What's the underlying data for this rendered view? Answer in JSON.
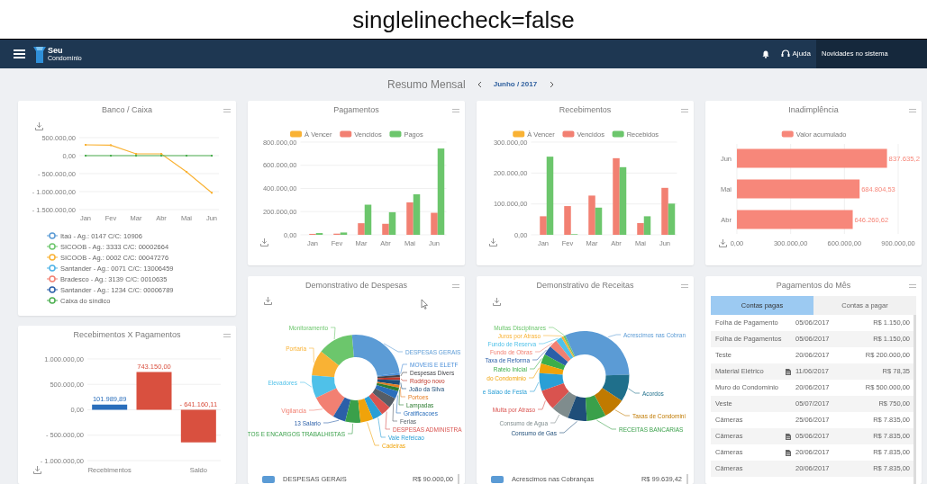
{
  "caption": "singlelinecheck=false",
  "header": {
    "brand_top": "Seu",
    "brand_bottom": "Condomínio",
    "help": "Ajuda",
    "news": "Novidades no sistema"
  },
  "summary": {
    "title": "Resumo Mensal",
    "period": "Junho / 2017"
  },
  "panels": [
    {
      "kind": "line",
      "chart_data": {
        "type": "line",
        "title": "Banco / Caixa",
        "grid": true,
        "legend": "bottom",
        "categories": [
          "Jan",
          "Fev",
          "Mar",
          "Abr",
          "Mai",
          "Jun"
        ],
        "ylim": [
          -1500000,
          500000
        ],
        "yticks": [
          {
            "value": 500000,
            "label": "500.000,00"
          },
          {
            "value": 0,
            "label": "0,00"
          },
          {
            "value": -500000,
            "label": "- 500.000,00"
          },
          {
            "value": -1000000,
            "label": "- 1.000.000,00"
          },
          {
            "value": -1500000,
            "label": "- 1.500.000,00"
          }
        ],
        "series": [
          {
            "name": "Itaú - Ag.: 0147 C/C: 10906",
            "color": "#5b9bd5",
            "values": [
              null,
              null,
              null,
              null,
              null,
              null
            ]
          },
          {
            "name": "SICOOB - Ag.: 3333 C/C: 00002664",
            "color": "#6cc66c",
            "values": [
              null,
              null,
              null,
              null,
              null,
              null
            ]
          },
          {
            "name": "SICOOB - Ag.: 0002 C/C: 00047276",
            "color": "#f9b234",
            "values": [
              300000,
              290000,
              50000,
              50000,
              -450000,
              -1030000
            ]
          },
          {
            "name": "Santander - Ag.: 0071 C/C: 13006459",
            "color": "#4fb3e6",
            "values": [
              null,
              null,
              null,
              null,
              null,
              null
            ]
          },
          {
            "name": "Bradesco - Ag.: 3139 C/C: 0010635",
            "color": "#f28072",
            "values": [
              null,
              null,
              null,
              null,
              null,
              null
            ]
          },
          {
            "name": "Santander - Ag.: 1234 C/C: 00006789",
            "color": "#2b5fa8",
            "values": [
              null,
              null,
              null,
              null,
              null,
              null
            ]
          },
          {
            "name": "Caixa do síndico",
            "color": "#4caf50",
            "values": [
              0,
              0,
              0,
              0,
              0,
              0
            ]
          }
        ]
      }
    },
    {
      "kind": "bar",
      "chart_data": {
        "type": "bar",
        "title": "Pagamentos",
        "grid": true,
        "legend": "top",
        "categories": [
          "Jan",
          "Fev",
          "Mar",
          "Abr",
          "Mai",
          "Jun"
        ],
        "ylim": [
          0,
          800000
        ],
        "yticks": [
          {
            "value": 0,
            "label": "0,00"
          },
          {
            "value": 200000,
            "label": "200.000,00"
          },
          {
            "value": 400000,
            "label": "400.000,00"
          },
          {
            "value": 600000,
            "label": "600.000,00"
          },
          {
            "value": 800000,
            "label": "800.000,00"
          }
        ],
        "series": [
          {
            "name": "À Vencer",
            "color": "#f9b234",
            "values": [
              0,
              0,
              0,
              0,
              0,
              0
            ]
          },
          {
            "name": "Vencidos",
            "color": "#f28072",
            "values": [
              8000,
              10000,
              100000,
              95000,
              280000,
              190000
            ]
          },
          {
            "name": "Pagos",
            "color": "#6cc66c",
            "values": [
              15000,
              20000,
              260000,
              195000,
              350000,
              745000
            ]
          }
        ]
      }
    },
    {
      "kind": "bar",
      "chart_data": {
        "type": "bar",
        "title": "Recebimentos",
        "grid": true,
        "legend": "top",
        "categories": [
          "Jan",
          "Fev",
          "Mar",
          "Abr",
          "Mai",
          "Jun"
        ],
        "ylim": [
          0,
          300000
        ],
        "yticks": [
          {
            "value": 0,
            "label": "0,00"
          },
          {
            "value": 100000,
            "label": "100.000,00"
          },
          {
            "value": 200000,
            "label": "200.000,00"
          },
          {
            "value": 300000,
            "label": "300.000,00"
          }
        ],
        "series": [
          {
            "name": "À Vencer",
            "color": "#f9b234",
            "values": [
              0,
              0,
              0,
              0,
              0,
              0
            ]
          },
          {
            "name": "Vencidos",
            "color": "#f28072",
            "values": [
              60000,
              93000,
              127000,
              248000,
              38000,
              152000
            ]
          },
          {
            "name": "Recebidos",
            "color": "#6cc66c",
            "values": [
              253000,
              2000,
              88000,
              219000,
              60000,
              101000
            ]
          }
        ]
      }
    },
    {
      "kind": "hbar",
      "chart_data": {
        "type": "bar",
        "orientation": "horizontal",
        "title": "Inadimplência",
        "grid": true,
        "legend": "top",
        "categories": [
          "Jun",
          "Mai",
          "Abr"
        ],
        "xlim": [
          0,
          900000
        ],
        "xticks": [
          {
            "value": 0,
            "label": "0,00"
          },
          {
            "value": 300000,
            "label": "300.000,00"
          },
          {
            "value": 600000,
            "label": "600.000,00"
          },
          {
            "value": 900000,
            "label": "900.000,00"
          }
        ],
        "series": [
          {
            "name": "Valor acumulado",
            "color": "#f7877a",
            "values": [
              837635.2,
              684804.53,
              646260.62
            ]
          }
        ],
        "value_labels": [
          "837.635,2",
          "684.804,53",
          "646.260,62"
        ]
      }
    },
    {
      "kind": "waterfall",
      "chart_data": {
        "type": "bar",
        "title": "Recebimentos X Pagamentos",
        "grid": true,
        "categories": [
          "Recebimentos",
          null,
          "Saldo"
        ],
        "ylim": [
          -1000000,
          1000000
        ],
        "yticks": [
          {
            "value": 1000000,
            "label": "1.000.000,00"
          },
          {
            "value": 500000,
            "label": "500.000,00"
          },
          {
            "value": 0,
            "label": "0,00"
          },
          {
            "value": -500000,
            "label": "- 500.000,00"
          },
          {
            "value": -1000000,
            "label": "- 1.000.000,00"
          }
        ],
        "series": [
          {
            "color": "#2a6ebb",
            "values": [
              101989.89,
              null,
              null
            ]
          },
          {
            "color": "#d9503f",
            "values": [
              null,
              743150,
              -641160.11
            ]
          }
        ],
        "value_labels": [
          "101.989,89",
          "743.150,00",
          "- 641.160,11"
        ]
      }
    },
    {
      "kind": "donut",
      "title": "Demonstrativo de Despesas",
      "labels": [
        {
          "text": "Monitoramento",
          "color": "#6cc66c"
        },
        {
          "text": "Portaria",
          "color": "#f9b234"
        },
        {
          "text": "Elevadores",
          "color": "#4fc1e9"
        },
        {
          "text": "Vigilancia",
          "color": "#f28072"
        },
        {
          "text": "13 Salario",
          "color": "#2b5fa8"
        },
        {
          "text": "TOS E ENCARGOS TRABALHISTAS",
          "color": "#3aa04a"
        },
        {
          "text": "DESPESAS GERAIS",
          "color": "#5b9bd5"
        },
        {
          "text": "MOVEIS E ELETF",
          "color": "#4a8fd9"
        },
        {
          "text": "Despesas Divers",
          "color": "#434348"
        },
        {
          "text": "Rodrigo novo",
          "color": "#c0392b"
        },
        {
          "text": "João da Silva",
          "color": "#1f4e79"
        },
        {
          "text": "Portoes",
          "color": "#e67e22"
        },
        {
          "text": "Lampadas",
          "color": "#2e7d32"
        },
        {
          "text": "Gratificacoes",
          "color": "#2a6ebb"
        },
        {
          "text": "Ferias",
          "color": "#555d66"
        },
        {
          "text": "DESPESAS ADMINISTRA",
          "color": "#d9534f"
        },
        {
          "text": "Vale Refeicao",
          "color": "#2a9fd6"
        },
        {
          "text": "Cadeiras",
          "color": "#f0a30a"
        }
      ],
      "summary": {
        "name": "DESPESAS GERAIS",
        "value": "R$ 90.000,00",
        "color": "#5b9bd5"
      }
    },
    {
      "kind": "donut",
      "title": "Demonstrativo de Receitas",
      "labels": [
        {
          "text": "Multas Disciplinares",
          "color": "#6cc66c"
        },
        {
          "text": "Juros por Atraso",
          "color": "#f9b234"
        },
        {
          "text": "Fundo de Reserva",
          "color": "#4fc1e9"
        },
        {
          "text": "Fundo de Obras",
          "color": "#f28072"
        },
        {
          "text": "Taxa de Reforma",
          "color": "#2b5fa8"
        },
        {
          "text": "Rateio Inicial",
          "color": "#3cae4a"
        },
        {
          "text": "do Condominio",
          "color": "#f0a30a"
        },
        {
          "text": "e Salao de Festa",
          "color": "#2a9fd6"
        },
        {
          "text": "Multa por Atraso",
          "color": "#d9534f"
        },
        {
          "text": "Consumo de Agua",
          "color": "#7f8c8d"
        },
        {
          "text": "Consumo de Gas",
          "color": "#1f4e79"
        },
        {
          "text": "Acrescimos nas Cobran",
          "color": "#5b9bd5"
        },
        {
          "text": "Acordos",
          "color": "#1f6f8b"
        },
        {
          "text": "Taxas de Condomini",
          "color": "#c07a00"
        },
        {
          "text": "RECEITAS BANCARIAS",
          "color": "#3aa04a"
        }
      ],
      "summary": {
        "name": "Acrescimos nas Cobranças",
        "value": "R$ 99.639,42",
        "color": "#5b9bd5"
      }
    },
    {
      "kind": "table",
      "title": "Pagamentos do Mês",
      "tabs": [
        {
          "label": "Contas pagas",
          "selected": true
        },
        {
          "label": "Contas a pagar",
          "selected": false
        }
      ],
      "rows": [
        {
          "description": "Folha de Pagamento",
          "attachment": false,
          "date": "05/06/2017",
          "amount": "R$ 1.150,00"
        },
        {
          "description": "Folha de Pagamentos",
          "attachment": false,
          "date": "05/06/2017",
          "amount": "R$ 1.150,00"
        },
        {
          "description": "Teste",
          "attachment": false,
          "date": "20/06/2017",
          "amount": "R$ 200.000,00"
        },
        {
          "description": "Material Elétrico",
          "attachment": true,
          "date": "11/06/2017",
          "amount": "R$ 78,35"
        },
        {
          "description": "Muro do Condomínio",
          "attachment": false,
          "date": "20/06/2017",
          "amount": "R$ 500.000,00"
        },
        {
          "description": "Veste",
          "attachment": false,
          "date": "05/07/2017",
          "amount": "R$ 750,00"
        },
        {
          "description": "Câmeras",
          "attachment": false,
          "date": "25/06/2017",
          "amount": "R$ 7.835,00"
        },
        {
          "description": "Câmeras",
          "attachment": true,
          "date": "05/06/2017",
          "amount": "R$ 7.835,00"
        },
        {
          "description": "Câmeras",
          "attachment": true,
          "date": "20/06/2017",
          "amount": "R$ 7.835,00"
        },
        {
          "description": "Câmeras",
          "attachment": false,
          "date": "20/06/2017",
          "amount": "R$ 7.835,00"
        }
      ]
    }
  ]
}
